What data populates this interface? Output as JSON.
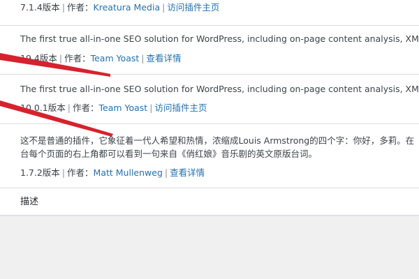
{
  "plugins": [
    {
      "version": "7.1.4版本",
      "author_label": "作者：",
      "author": "Kreatura Media",
      "link": "访问插件主页"
    },
    {
      "description": "The first true all-in-one SEO solution for WordPress, including on-page content analysis, XML sitemaps",
      "version": "19.4版本",
      "author_label": "作者：",
      "author": "Team Yoast",
      "link": "查看详情"
    },
    {
      "description": "The first true all-in-one SEO solution for WordPress, including on-page content analysis, XML sitemaps",
      "version": "10.0.1版本",
      "author_label": "作者：",
      "author": "Team Yoast",
      "link": "访问插件主页"
    },
    {
      "description_line1": "这不是普通的插件，它象征着一代人希望和热情，浓缩成Louis Armstrong的四个字：你好，多莉。在",
      "description_line2": "台每个页面的右上角都可以看到一句来自《俏红娘》音乐剧的英文原版台词。",
      "version": "1.7.2版本",
      "author_label": "作者：",
      "author": "Matt Mullenweg",
      "link": "查看详情"
    }
  ],
  "footer_column": "描述",
  "colors": {
    "link": "#2271b1",
    "text": "#3c434a",
    "annotation_arrow": "#d6222e"
  }
}
